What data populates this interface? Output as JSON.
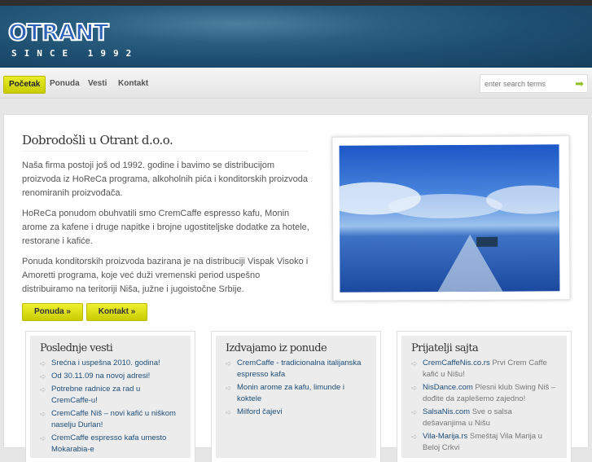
{
  "logo": {
    "name": "OTRANT",
    "tagline": "SINCE 1992"
  },
  "nav": {
    "items": [
      "Početak",
      "Ponuda",
      "Vesti",
      "Kontakt"
    ],
    "search_placeholder": "enter search terms"
  },
  "main": {
    "title": "Dobrodošli u Otrant d.o.o.",
    "paragraphs": [
      "Naša firma postoji još od 1992. godine i bavimo se distribucijom proizvoda iz HoReCa programa, alkoholnih pića i konditorskih proizvoda renomiranih proizvođača.",
      "HoReCa ponudom obuhvatili smo CremCaffe espresso kafu, Monin arome za kafene i druge napitke i brojne ugostiteljske dodatke za hotele, restorane i kafiće.",
      "Ponuda konditorskih proizvoda bazirana je na distribuciji Vispak Visoko i Amoretti programa, koje već duži vremenski period uspešno distribuiramo na teritoriji Niša, južne i jugoistočne Srbije."
    ],
    "buttons": [
      "Ponuda »",
      "Kontakt »"
    ]
  },
  "boxes": [
    {
      "title": "Poslednje vesti",
      "items": [
        {
          "link": "Srećna i uspešna 2010. godina!"
        },
        {
          "link": "Od 30.11.09 na novoj adresi!"
        },
        {
          "link": "Potrebne radnice za rad u CremCaffe-u!"
        },
        {
          "link": "CremCaffe Niš – novi kafić u niškom naselju Durlan!"
        },
        {
          "link": "CremCaffe espresso kafa umesto Mokarabia-e"
        }
      ]
    },
    {
      "title": "Izdvajamo iz ponude",
      "items": [
        {
          "link": "CremCaffe - tradicionalna italijanska espresso kafa"
        },
        {
          "link": "Monin arome za kafu, limunde i koktele"
        },
        {
          "link": "Milford čajevi"
        }
      ]
    },
    {
      "title": "Prijatelji sajta",
      "items": [
        {
          "link": "CremCaffeNis.co.rs",
          "text": "Prvi Crem Caffe kafić u Nišu!"
        },
        {
          "link": "NisDance.com",
          "text": "Plesni klub Swing Niš – dođite da zaplešemo zajedno!"
        },
        {
          "link": "SalsaNis.com",
          "text": "Sve o salsa dešavanjima u Nišu"
        },
        {
          "link": "Vila-Marija.rs",
          "text": "Smeštaj Vila Marija u Beloj Crkvi"
        }
      ]
    }
  ]
}
